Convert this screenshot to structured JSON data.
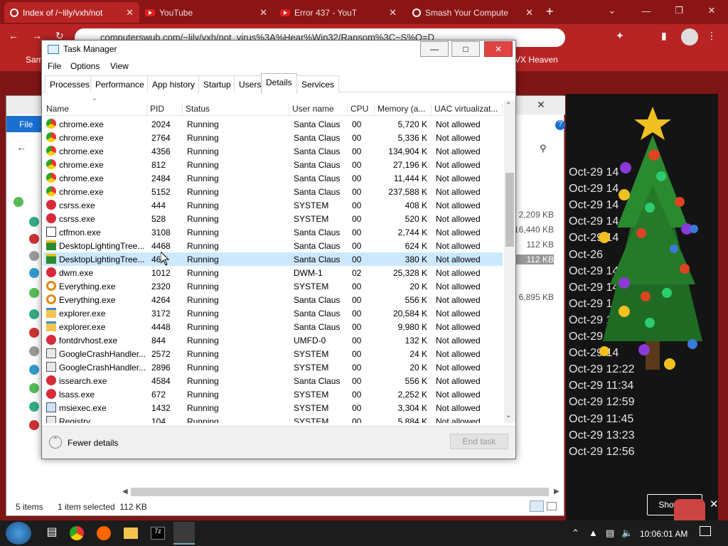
{
  "browser": {
    "tabs": [
      {
        "label": "Index of /~lily/vxh/not",
        "icon": "page-icon"
      },
      {
        "label": "YouTube",
        "icon": "youtube-icon"
      },
      {
        "label": "Error 437 - YouT",
        "icon": "youtube-icon"
      },
      {
        "label": "Smash Your Compute",
        "icon": "globe-icon"
      }
    ],
    "address": "computerswub.com/~lily/vxh/not_virus%3A%Hear%Win32/Ransom%3C~S%Q=D",
    "bookmarks": [
      "Sam",
      "VX Heaven"
    ]
  },
  "page_times": [
    "Oct-29 14",
    "Oct-29 14",
    "Oct-29 14",
    "Oct-29 14",
    "Oct-29 14",
    "Oct-26",
    "Oct-29 14",
    "Oct-29 14",
    "Oct-29 14",
    "Oct-29 13",
    "Oct-29 14",
    "Oct-29 14",
    "Oct-29 12:22",
    "Oct-29 11:34",
    "Oct-29 12:59",
    "Oct-29 11:45",
    "Oct-29 13:23",
    "Oct-29 12:56"
  ],
  "explorer": {
    "file_tab": "File",
    "sizes": [
      "2,209 KB",
      "16,440 KB",
      "112 KB",
      "112 KB",
      "6,895 KB"
    ],
    "status_items": "5 items",
    "status_selected": "1 item selected  112 KB"
  },
  "task_manager": {
    "title": "Task Manager",
    "menu": [
      "File",
      "Options",
      "View"
    ],
    "tabs": [
      "Processes",
      "Performance",
      "App history",
      "Startup",
      "Users",
      "Details",
      "Services"
    ],
    "active_tab": "Details",
    "columns": [
      "Name",
      "PID",
      "Status",
      "User name",
      "CPU",
      "Memory (a...",
      "UAC virtualizat..."
    ],
    "rows": [
      {
        "icon": "chrome-icon",
        "name": "chrome.exe",
        "pid": "2024",
        "status": "Running",
        "user": "Santa Claus",
        "cpu": "00",
        "mem": "5,720 K",
        "uac": "Not allowed"
      },
      {
        "icon": "chrome-icon",
        "name": "chrome.exe",
        "pid": "2764",
        "status": "Running",
        "user": "Santa Claus",
        "cpu": "00",
        "mem": "5,336 K",
        "uac": "Not allowed"
      },
      {
        "icon": "chrome-icon",
        "name": "chrome.exe",
        "pid": "4356",
        "status": "Running",
        "user": "Santa Claus",
        "cpu": "00",
        "mem": "134,904 K",
        "uac": "Not allowed"
      },
      {
        "icon": "chrome-icon",
        "name": "chrome.exe",
        "pid": "812",
        "status": "Running",
        "user": "Santa Claus",
        "cpu": "00",
        "mem": "27,196 K",
        "uac": "Not allowed"
      },
      {
        "icon": "chrome-icon",
        "name": "chrome.exe",
        "pid": "2484",
        "status": "Running",
        "user": "Santa Claus",
        "cpu": "00",
        "mem": "11,444 K",
        "uac": "Not allowed"
      },
      {
        "icon": "chrome-icon",
        "name": "chrome.exe",
        "pid": "5152",
        "status": "Running",
        "user": "Santa Claus",
        "cpu": "00",
        "mem": "237,588 K",
        "uac": "Not allowed"
      },
      {
        "icon": "ornament-icon",
        "name": "csrss.exe",
        "pid": "444",
        "status": "Running",
        "user": "SYSTEM",
        "cpu": "00",
        "mem": "408 K",
        "uac": "Not allowed"
      },
      {
        "icon": "ornament-icon",
        "name": "csrss.exe",
        "pid": "528",
        "status": "Running",
        "user": "SYSTEM",
        "cpu": "00",
        "mem": "520 K",
        "uac": "Not allowed"
      },
      {
        "icon": "ctfmon-icon",
        "name": "ctfmon.exe",
        "pid": "3108",
        "status": "Running",
        "user": "Santa Claus",
        "cpu": "00",
        "mem": "2,744 K",
        "uac": "Not allowed"
      },
      {
        "icon": "tree-icon",
        "name": "DesktopLightingTree...",
        "pid": "4468",
        "status": "Running",
        "user": "Santa Claus",
        "cpu": "00",
        "mem": "624 K",
        "uac": "Not allowed"
      },
      {
        "icon": "tree-icon",
        "name": "DesktopLightingTree...",
        "pid": "46..",
        "status": "Running",
        "user": "Santa Claus",
        "cpu": "00",
        "mem": "380 K",
        "uac": "Not allowed"
      },
      {
        "icon": "ornament-icon",
        "name": "dwm.exe",
        "pid": "1012",
        "status": "Running",
        "user": "DWM-1",
        "cpu": "02",
        "mem": "25,328 K",
        "uac": "Not allowed"
      },
      {
        "icon": "search-icon",
        "name": "Everything.exe",
        "pid": "2320",
        "status": "Running",
        "user": "SYSTEM",
        "cpu": "00",
        "mem": "20 K",
        "uac": "Not allowed"
      },
      {
        "icon": "search-icon",
        "name": "Everything.exe",
        "pid": "4264",
        "status": "Running",
        "user": "Santa Claus",
        "cpu": "00",
        "mem": "556 K",
        "uac": "Not allowed"
      },
      {
        "icon": "folder-icon",
        "name": "explorer.exe",
        "pid": "3172",
        "status": "Running",
        "user": "Santa Claus",
        "cpu": "00",
        "mem": "20,584 K",
        "uac": "Not allowed"
      },
      {
        "icon": "folder-icon",
        "name": "explorer.exe",
        "pid": "4448",
        "status": "Running",
        "user": "Santa Claus",
        "cpu": "00",
        "mem": "9,980 K",
        "uac": "Not allowed"
      },
      {
        "icon": "ornament-icon",
        "name": "fontdrvhost.exe",
        "pid": "844",
        "status": "Running",
        "user": "UMFD-0",
        "cpu": "00",
        "mem": "132 K",
        "uac": "Not allowed"
      },
      {
        "icon": "app-icon",
        "name": "GoogleCrashHandler...",
        "pid": "2572",
        "status": "Running",
        "user": "SYSTEM",
        "cpu": "00",
        "mem": "24 K",
        "uac": "Not allowed"
      },
      {
        "icon": "app-icon",
        "name": "GoogleCrashHandler...",
        "pid": "2896",
        "status": "Running",
        "user": "SYSTEM",
        "cpu": "00",
        "mem": "20 K",
        "uac": "Not allowed"
      },
      {
        "icon": "ornament-icon",
        "name": "issearch.exe",
        "pid": "4584",
        "status": "Running",
        "user": "Santa Claus",
        "cpu": "00",
        "mem": "556 K",
        "uac": "Not allowed"
      },
      {
        "icon": "ornament-icon",
        "name": "lsass.exe",
        "pid": "672",
        "status": "Running",
        "user": "SYSTEM",
        "cpu": "00",
        "mem": "2,252 K",
        "uac": "Not allowed"
      },
      {
        "icon": "installer-icon",
        "name": "msiexec.exe",
        "pid": "1432",
        "status": "Running",
        "user": "SYSTEM",
        "cpu": "00",
        "mem": "3,304 K",
        "uac": "Not allowed"
      },
      {
        "icon": "app-icon",
        "name": "Registry",
        "pid": "104",
        "status": "Running",
        "user": "SYSTEM",
        "cpu": "00",
        "mem": "5,884 K",
        "uac": "Not allowed"
      }
    ],
    "highlighted_row": 10,
    "fewer_details": "Fewer details",
    "end_task": "End task"
  },
  "overlay": {
    "show_all": "Show all"
  },
  "taskbar": {
    "time": "10:06:01 AM"
  }
}
